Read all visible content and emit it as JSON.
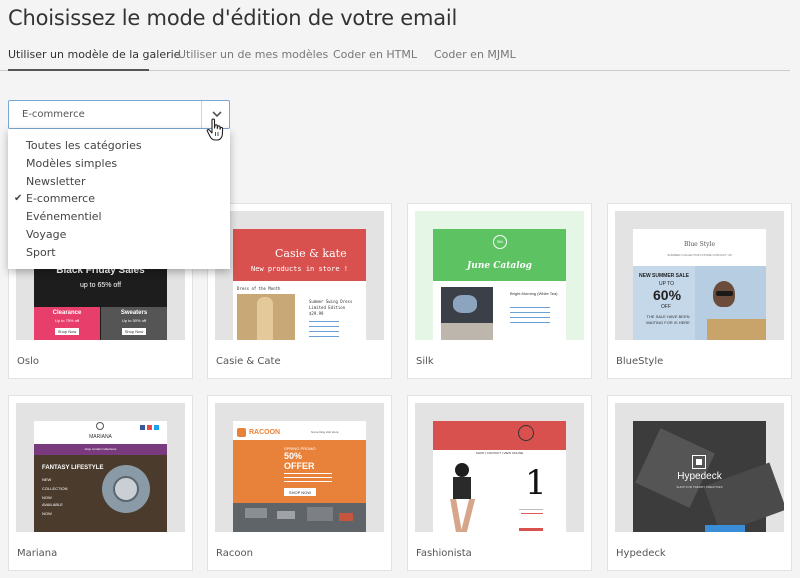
{
  "title": "Choisissez le mode d'édition de votre email",
  "tabs": [
    {
      "label": "Utiliser un modèle de la galerie",
      "active": true
    },
    {
      "label": "Utiliser un de mes modèles",
      "active": false
    },
    {
      "label": "Coder en HTML",
      "active": false
    },
    {
      "label": "Coder en MJML",
      "active": false
    }
  ],
  "category_select": {
    "value": "E-commerce",
    "options": [
      "Toutes les catégories",
      "Modèles simples",
      "Newsletter",
      "E-commerce",
      "Evénementiel",
      "Voyage",
      "Sport"
    ],
    "checked": "E-commerce"
  },
  "templates": [
    {
      "name": "Oslo",
      "preview": {
        "headline": "Black Friday Sales",
        "discount": "up to 65% off",
        "promo1": "Clearance",
        "promo1_sub": "Up to 75% off",
        "promo2": "Sweaters",
        "promo2_sub": "Up to 50% off",
        "button": "Shop Now"
      }
    },
    {
      "name": "Casie & Cate",
      "preview": {
        "logo": "Casie & kate",
        "banner": "New products in store !",
        "left_title": "Dress of the Month",
        "right_title": "Summer Swing Dress",
        "right_sub": "Limited Edition",
        "price": "$29.99"
      }
    },
    {
      "name": "Silk",
      "preview": {
        "badge": "Silk",
        "title": "June Catalog",
        "item_title": "Bright Morning (White Tea)"
      }
    },
    {
      "name": "BlueStyle",
      "preview": {
        "logo": "Blue Style",
        "nav": "SUMMER COLLECTION   STORE   CONTACT   US",
        "sale": "NEW SUMMER SALE",
        "up_to": "UP TO",
        "percent": "60%",
        "off": "OFF",
        "body": "THE SALE HAVE BEEN WAITING FOR IS HERE"
      }
    },
    {
      "name": "Mariana",
      "preview": {
        "logo": "MARIANA",
        "nav": "shop     contact     collections",
        "headline": "FANTASY LIFESTYLE",
        "lines": [
          "NEW",
          "COLLECTION",
          "NOW",
          "AVAILABLE",
          "NOW"
        ]
      }
    },
    {
      "name": "Racoon",
      "preview": {
        "logo": "RACOON",
        "nav": "home     blog     visit store",
        "promo": "SPRING PROMO",
        "percent": "50%",
        "offer": "OFFER",
        "button": "SHOP NOW"
      }
    },
    {
      "name": "Fashionista",
      "preview": {
        "nav": "SHOP  |  CONTACT  |  VIEW ONLINE",
        "number": "1"
      }
    },
    {
      "name": "Hypedeck",
      "preview": {
        "logo": "Hypedeck",
        "sub": "SHOP FOR TRENDY CREATIVES"
      }
    }
  ],
  "colors": {
    "accent_border": "#7aa7d6",
    "casie_red": "#d9514e",
    "silk_green": "#5cc262",
    "racoon_orange": "#e8823a",
    "oslo_pink": "#e83e6c"
  }
}
